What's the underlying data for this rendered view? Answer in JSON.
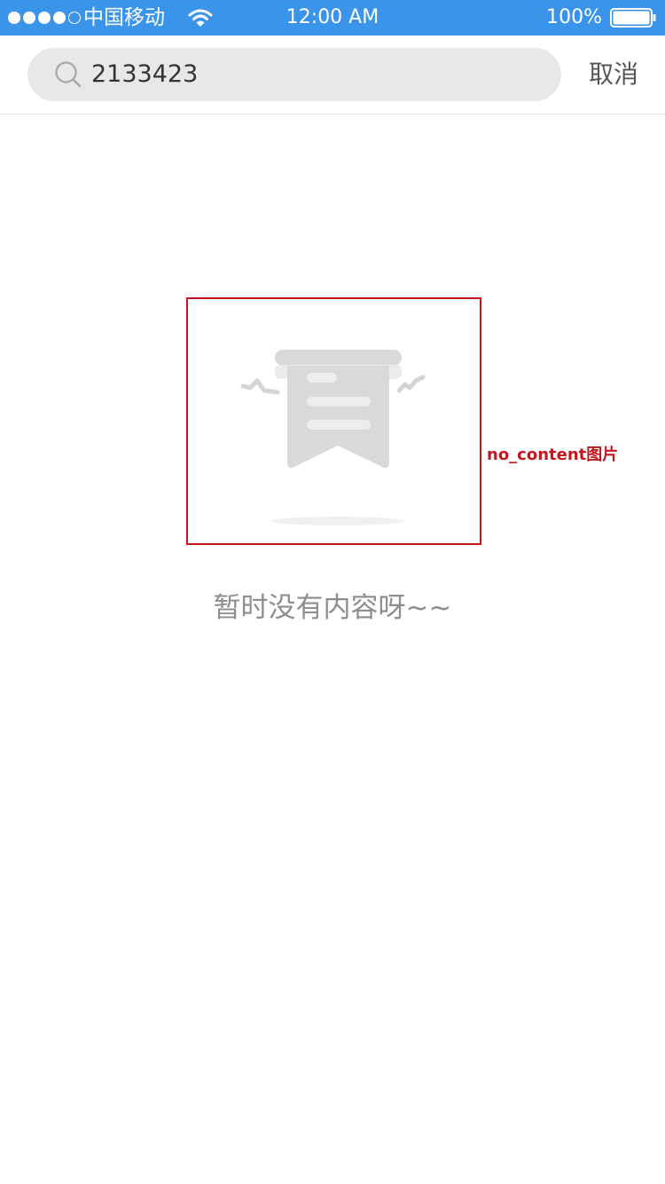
{
  "status_bar": {
    "carrier": "中国移动",
    "signal_bars_filled": 4,
    "signal_bars_total": 5,
    "time": "12:00 AM",
    "battery_percent": "100%",
    "battery_level": 1.0,
    "icons": [
      "signal-dots-icon",
      "wifi-icon",
      "battery-icon"
    ]
  },
  "search": {
    "query": "2133423",
    "icon": "search-icon",
    "cancel_label": "取消"
  },
  "empty_state": {
    "illustration_icon": "no-content-bookmark-icon",
    "annotation_label": "no_content图片",
    "message": "暂时没有内容呀~~"
  },
  "colors": {
    "status_bar_bg": "#3a95ea",
    "search_box_bg": "#e8e8e8",
    "annotation": "#c4161c",
    "illustration": "#d9d9d9",
    "message_text": "#8e8e8e"
  }
}
